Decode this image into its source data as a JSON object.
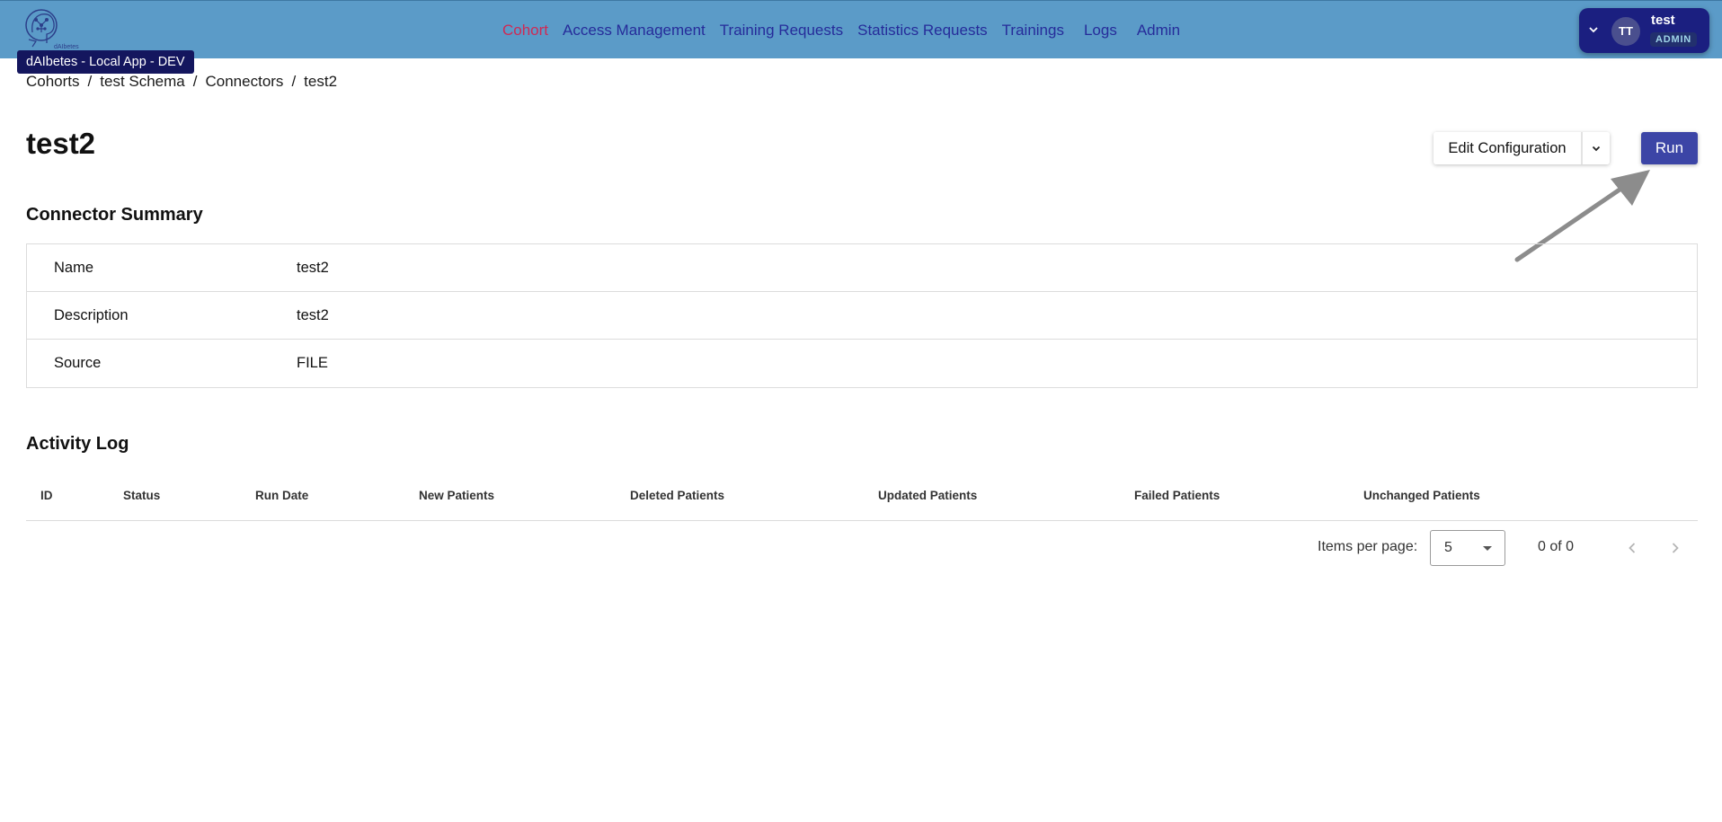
{
  "app": {
    "logo_icon": "brain-logo-icon",
    "env_badge": "dAIbetes - Local App - DEV"
  },
  "nav": {
    "items": [
      {
        "label": "Cohort",
        "active": true
      },
      {
        "label": "Access Management",
        "active": false
      },
      {
        "label": "Training Requests",
        "active": false
      },
      {
        "label": "Statistics Requests",
        "active": false
      },
      {
        "label": "Trainings",
        "active": false
      },
      {
        "label": "Logs",
        "active": false
      },
      {
        "label": "Admin",
        "active": false
      }
    ]
  },
  "user": {
    "initials": "TT",
    "name": "test",
    "role": "ADMIN"
  },
  "breadcrumb": {
    "items": [
      "Cohorts",
      "test Schema",
      "Connectors",
      "test2"
    ],
    "separator": "/"
  },
  "page": {
    "title": "test2",
    "edit_label": "Edit Configuration",
    "run_label": "Run"
  },
  "summary": {
    "title": "Connector Summary",
    "rows": [
      {
        "key": "Name",
        "value": "test2"
      },
      {
        "key": "Description",
        "value": "test2"
      },
      {
        "key": "Source",
        "value": "FILE"
      }
    ]
  },
  "activity": {
    "title": "Activity Log",
    "columns": [
      "ID",
      "Status",
      "Run Date",
      "New Patients",
      "Deleted Patients",
      "Updated Patients",
      "Failed Patients",
      "Unchanged Patients"
    ],
    "rows": []
  },
  "pagination": {
    "items_per_page_label": "Items per page:",
    "items_per_page": "5",
    "range": "0 of 0"
  },
  "colors": {
    "topbar": "#5b9bc8",
    "nav_link": "#262c9a",
    "nav_active": "#cf2a55",
    "primary": "#3c45a6",
    "badge": "#14165e"
  }
}
